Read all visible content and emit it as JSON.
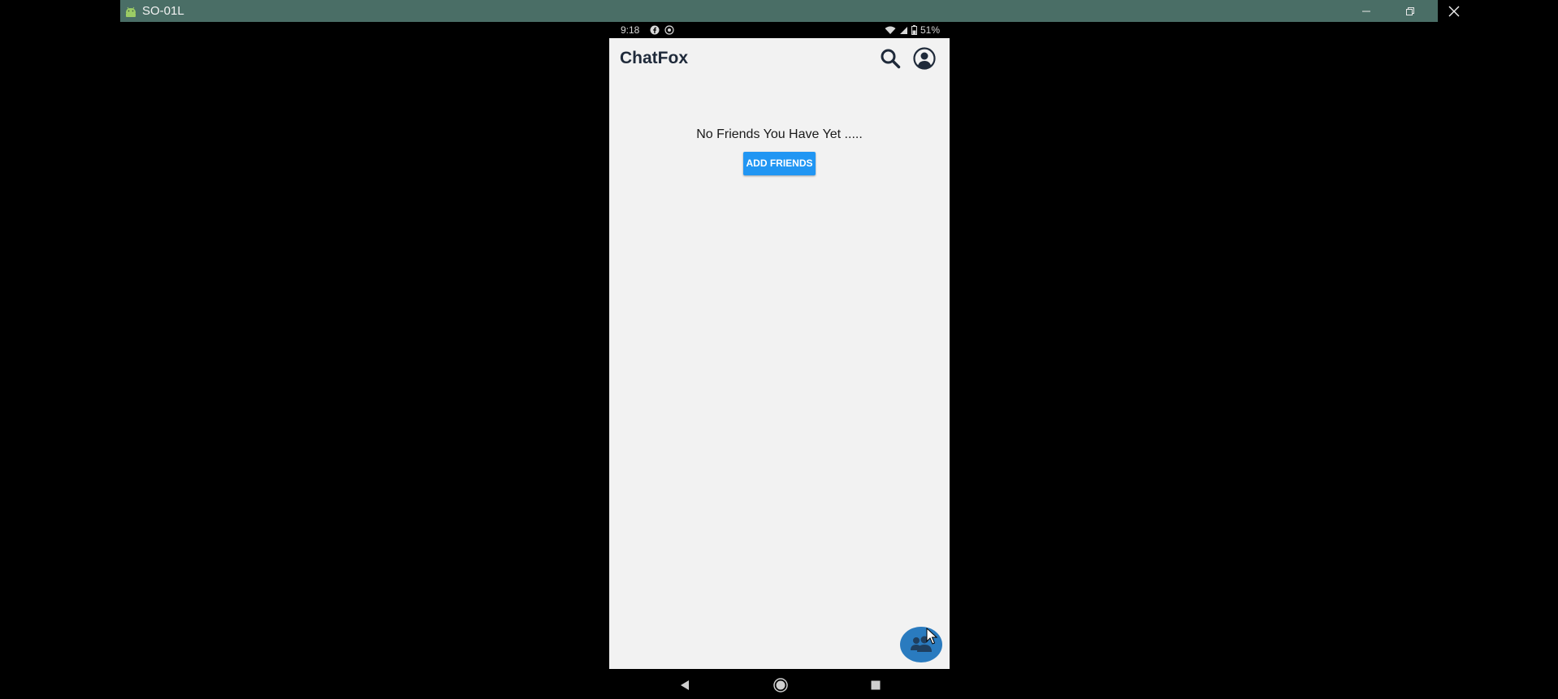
{
  "window": {
    "title": "SO-01L",
    "icon": "android-icon",
    "controls": [
      "minimize-icon",
      "restore-icon",
      "close-icon"
    ],
    "bar_color": "#4a6e66"
  },
  "status_bar": {
    "time": "9:18",
    "notification_icons": [
      "facebook-icon",
      "app-notification-icon"
    ],
    "battery": "51%",
    "status_icons": [
      "wifi-icon",
      "signal-icon",
      "battery-icon"
    ]
  },
  "app_bar": {
    "title": "ChatFox",
    "actions": [
      "search-icon",
      "profile-icon"
    ]
  },
  "main": {
    "empty_message": "No Friends You Have Yet .....",
    "add_friends_label": "ADD FRIENDS"
  },
  "fab": {
    "icon": "group-icon"
  },
  "nav_bar": {
    "buttons": [
      "back-icon",
      "home-icon",
      "recents-icon"
    ]
  },
  "colors": {
    "accent": "#2196f3",
    "fab": "#2a7bbf",
    "background": "#f2f2f2",
    "title_text": "#1f2a3a"
  }
}
